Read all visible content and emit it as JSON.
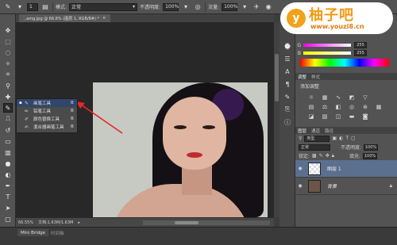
{
  "options_bar": {
    "brush_size": "1",
    "mode_label": "模式:",
    "mode_value": "正常",
    "opacity_label": "不透明度:",
    "opacity_value": "100%",
    "flow_label": "流量:",
    "flow_value": "100%"
  },
  "document_tab": {
    "title": "..amg.jpg @ 66.6% (图层 1, RGB/8#) *",
    "close": "×"
  },
  "flyout": {
    "items": [
      {
        "label": "画笔工具",
        "key": "B",
        "selected": true,
        "icon": "brush-icon"
      },
      {
        "label": "铅笔工具",
        "key": "B",
        "selected": false,
        "icon": "pencil-icon"
      },
      {
        "label": "颜色替换工具",
        "key": "B",
        "selected": false,
        "icon": "color-replace-icon"
      },
      {
        "label": "混合器画笔工具",
        "key": "B",
        "selected": false,
        "icon": "mixer-brush-icon"
      }
    ]
  },
  "status_bar": {
    "zoom": "66.55%",
    "doc_info": "文档:1.63M/1.63M"
  },
  "bottom_tabs": {
    "mini_bridge": "Mini Bridge",
    "timeline": "时间轴"
  },
  "color_panel": {
    "rows": [
      {
        "label": "G",
        "value": "255"
      },
      {
        "label": "B",
        "value": "255"
      }
    ]
  },
  "adjustments_panel": {
    "tab_active": "调整",
    "tab_other": "样式",
    "add_label": "添加调整"
  },
  "layers_panel": {
    "tabs": [
      "图层",
      "通道",
      "路径"
    ],
    "filter": "类型",
    "blend_mode": "正常",
    "opacity_label": "不透明度:",
    "opacity_value": "100%",
    "lock_label": "锁定:",
    "fill_label": "填充:",
    "fill_value": "100%",
    "layers": [
      {
        "name": "图层 1",
        "selected": true
      },
      {
        "name": "背景",
        "selected": false
      }
    ]
  },
  "watermark": {
    "letter": "y",
    "title": "柚子吧",
    "url": "www.youzi8.cn"
  },
  "colors": {
    "accent_arrow": "#e8262a",
    "selection": "#32456b",
    "layer_selected": "#5b6f8f",
    "logo_orange": "#f39a14"
  }
}
